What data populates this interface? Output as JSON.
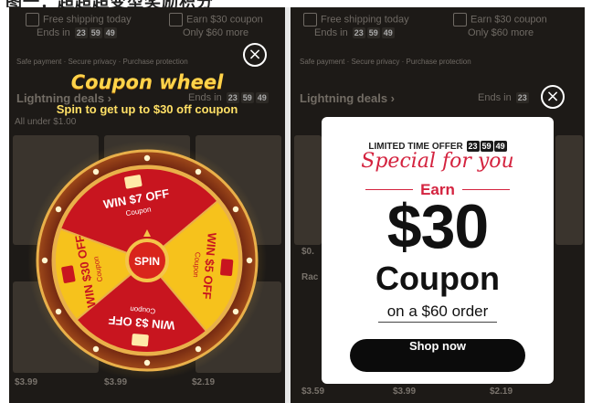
{
  "caption": {
    "text": "图一：超超超变型奖励积分"
  },
  "background": {
    "free_shipping": "Free shipping today",
    "free_shipping_sub": "Ends in",
    "earn_coupon": "Earn $30 coupon",
    "earn_coupon_sub": "Only $60 more",
    "safe_payment": "Safe payment · Secure privacy · Purchase protection",
    "lightning_deals": "Lightning deals ›",
    "ends_in": "Ends in",
    "all_under": "All under $1.00",
    "timer": [
      "23",
      "59",
      "49"
    ],
    "prices_left": [
      "$3.99",
      "$3.99",
      "$2.19"
    ],
    "prices_right": [
      "$3.59",
      "$3.99",
      "$2.19"
    ],
    "side_left_1": "$0.",
    "side_left_2": "Rac"
  },
  "wheel": {
    "title": "Coupon wheel",
    "subtitle": "Spin to get up to $30 off coupon",
    "close_icon": "×",
    "spin_label": "SPIN",
    "segments": [
      {
        "win": "WIN",
        "amount": "$7",
        "off": "OFF",
        "coupon": "Coupon"
      },
      {
        "win": "WIN",
        "amount": "$5",
        "off": "OFF",
        "coupon": "Coupon"
      },
      {
        "win": "WIN",
        "amount": "$3",
        "off": "OFF",
        "coupon": "Coupon"
      },
      {
        "win": "WIN",
        "amount": "$30",
        "off": "OFF",
        "coupon": "Coupon"
      }
    ],
    "colors": {
      "red": "#c8151f",
      "yellow": "#f6c21c",
      "rim": "#7a2a12",
      "gold": "#e9b04a"
    }
  },
  "popup": {
    "limited": "LIMITED TIME OFFER",
    "timer": [
      "23",
      "59",
      "49"
    ],
    "special": "Special for you",
    "earn": "Earn",
    "amount": "$30",
    "coupon": "Coupon",
    "order": "on a $60 order",
    "shop_now": "Shop now",
    "close_icon": "×"
  }
}
